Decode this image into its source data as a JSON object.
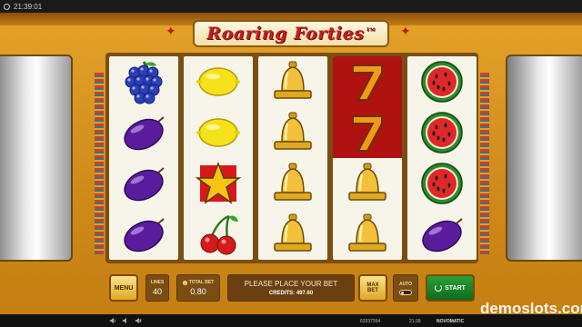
{
  "status_bar": {
    "time": "21:39:01"
  },
  "logo": {
    "text": "Roaring Forties",
    "tm": "TM"
  },
  "reels": [
    {
      "symbols": [
        "grapes",
        "plum",
        "plum",
        "plum"
      ]
    },
    {
      "symbols": [
        "lemon",
        "lemon",
        "star",
        "cherries"
      ]
    },
    {
      "symbols": [
        "bell",
        "bell",
        "bell",
        "bell"
      ]
    },
    {
      "symbols": [
        "seven",
        "seven",
        "bell",
        "bell"
      ],
      "highlight": [
        0,
        1
      ]
    },
    {
      "symbols": [
        "watermelon",
        "watermelon",
        "watermelon",
        "plum"
      ]
    }
  ],
  "controls": {
    "menu_label": "MENU",
    "lines_label": "LINES",
    "lines_value": "40",
    "total_bet_label": "TOTAL BET",
    "total_bet_value": "0.80",
    "message": "PLEASE PLACE YOUR BET",
    "credits_label": "CREDITS:",
    "credits_value": "497.60",
    "max_bet_label_1": "MAX",
    "max_bet_label_2": "BET",
    "auto_label": "AUTO",
    "start_label": "START"
  },
  "footer": {
    "id": "63337994",
    "time": "21:39",
    "brand": "NOVOMATIC"
  },
  "watermark": {
    "text": "demoslots.com"
  },
  "colors": {
    "cabinet": "#d9951f",
    "reel_bg": "#f7f4ea",
    "highlight": "#b01212",
    "start": "#1f8a2c"
  }
}
